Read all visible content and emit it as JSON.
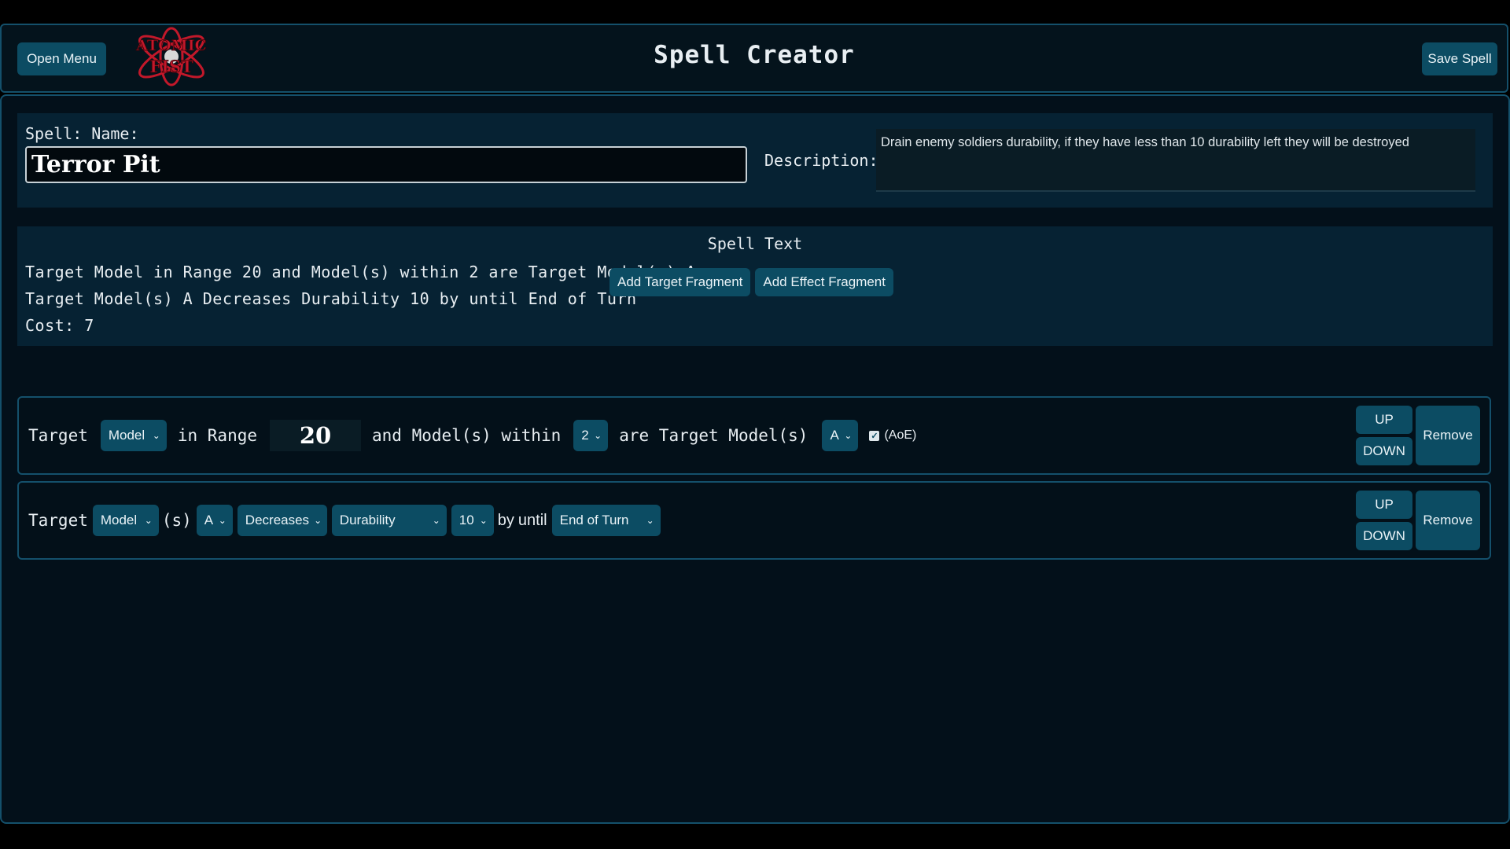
{
  "header": {
    "open_menu_label": "Open Menu",
    "title": "Spell Creator",
    "save_label": "Save Spell",
    "logo_text": "ATOMIC FIST"
  },
  "spell_name": {
    "label": "Spell: Name:",
    "value": "Terror Pit"
  },
  "description": {
    "label": "Description:",
    "value": "Drain enemy soldiers durability, if they have less than 10 durability left they will be destroyed"
  },
  "spell_text": {
    "title": "Spell Text",
    "lines": [
      "Target Model in Range 20 and Model(s) within 2 are Target Model(s) A",
      "Target Model(s) A Decreases Durability 10 by until End of Turn"
    ],
    "cost": "Cost: 7"
  },
  "actions": {
    "add_target": "Add Target Fragment",
    "add_effect": "Add Effect Fragment"
  },
  "fragment1": {
    "t_target": "Target",
    "model_select": "Model",
    "t_in_range": "in Range",
    "range_value": "20",
    "t_and_models": "and Model(s) within",
    "within_select": "2",
    "t_are_target": "are Target Model(s)",
    "group_select": "A",
    "aoe_label": "(AoE)",
    "aoe_checked": true,
    "up_label": "UP",
    "down_label": "DOWN",
    "remove_label": "Remove"
  },
  "fragment2": {
    "t_target": "Target",
    "model_select": "Model",
    "t_s": "(s)",
    "group_select": "A",
    "change_select": "Decreases",
    "stat_select": "Durability",
    "amount_select": "10",
    "t_by": "by",
    "t_until": "until",
    "duration_select": "End of Turn",
    "up_label": "UP",
    "down_label": "DOWN",
    "remove_label": "Remove"
  },
  "colors": {
    "accent": "#0c4c63",
    "panel": "#062233",
    "border": "#14506b",
    "logo_red": "#c2182a"
  }
}
